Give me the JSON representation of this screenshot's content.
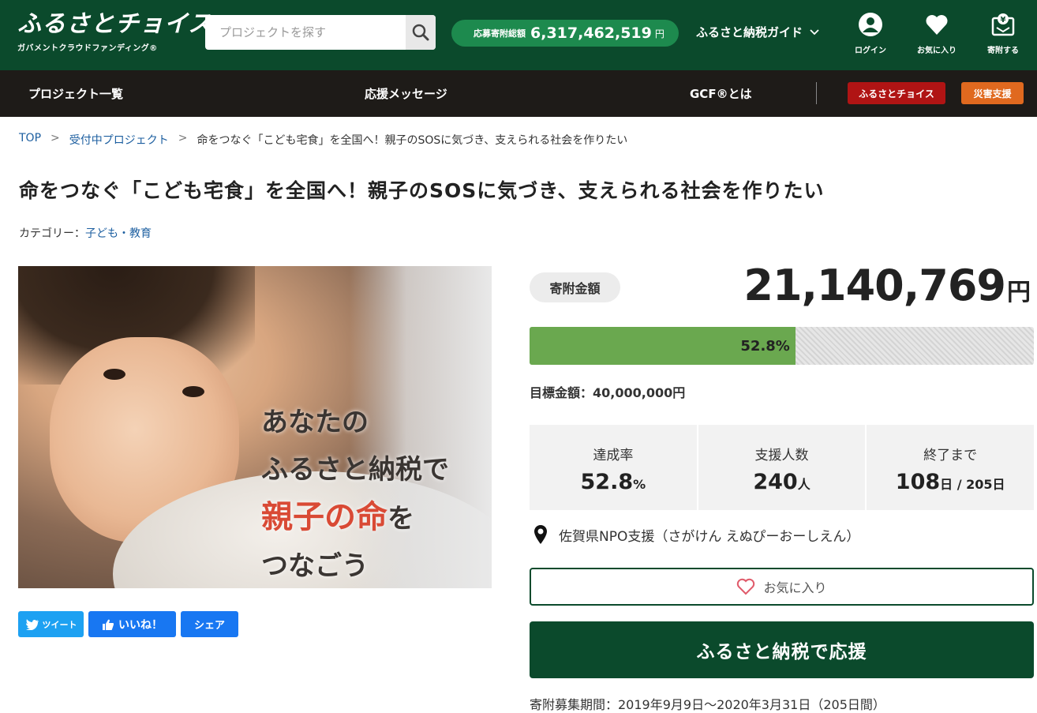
{
  "header": {
    "logo_main": "ふるさとチョイス",
    "logo_sub": "ガバメントクラウドファンディング®",
    "search_placeholder": "プロジェクトを探す",
    "total_label": "応募寄附総額",
    "total_value": "6,317,462,519",
    "total_unit": "円",
    "guide_label": "ふるさと納税ガイド",
    "icons": [
      {
        "name": "login",
        "label": "ログイン"
      },
      {
        "name": "favorites",
        "label": "お気に入り"
      },
      {
        "name": "donate",
        "label": "寄附する"
      }
    ]
  },
  "nav": {
    "items": [
      "プロジェクト一覧",
      "応援メッセージ",
      "GCF®とは"
    ],
    "furusato_button": "ふるさとチョイス",
    "disaster_button": "災害支援",
    "colors": {
      "furusato": "#b01414",
      "disaster": "#e0691f"
    }
  },
  "breadcrumb": {
    "items": [
      "TOP",
      "受付中プロジェクト",
      "命をつなぐ「こども宅食」を全国へ！親子のSOSに気づき、支えられる社会を作りたい"
    ],
    "separator": ">"
  },
  "project": {
    "title": "命をつなぐ「こども宅食」を全国へ！親子のSOSに気づき、支えられる社会を作りたい",
    "category_label": "カテゴリー：",
    "category_value": "子ども・教育",
    "image_text": {
      "line1": "あなたの",
      "line2": "ふるさと納税で",
      "line3_red": "親子の命",
      "line3_rest": "を",
      "line4": "つなごう"
    }
  },
  "social": {
    "tweet": "ツイート",
    "like": "いいね！",
    "share": "シェア",
    "colors": {
      "tweet": "#1da1f2",
      "like": "#1877f2",
      "share": "#1877f2"
    }
  },
  "funding": {
    "amount_label": "寄附金額",
    "amount": "21,140,769",
    "amount_unit": "円",
    "progress_percent": 52.8,
    "progress_label": "52.8%",
    "goal_text": "目標金額：40,000,000円",
    "stats": [
      {
        "label": "達成率",
        "value": "52.8",
        "unit": "%"
      },
      {
        "label": "支援人数",
        "value": "240",
        "unit": "人"
      },
      {
        "label": "終了まで",
        "value": "108",
        "unit": "日 / 205日"
      }
    ],
    "location": "佐賀県NPO支援（さがけん えぬぴーおーしえん）",
    "favorite_button": "お気に入り",
    "donate_button": "ふるさと納税で応援",
    "period": "寄附募集期間：2019年9月9日～2020年3月31日（205日間）"
  }
}
